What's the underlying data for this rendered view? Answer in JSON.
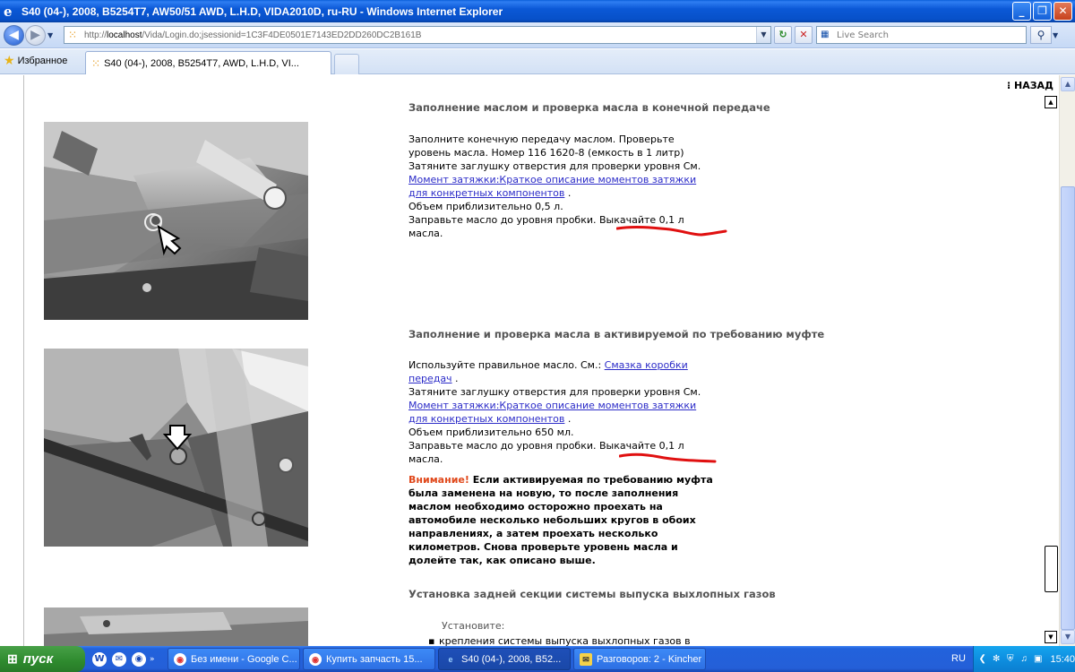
{
  "window": {
    "title": "S40 (04-), 2008, B5254T7, AW50/51 AWD, L.H.D, VIDA2010D, ru-RU - Windows Internet Explorer",
    "buttons": {
      "minimize": "_",
      "maximize": "❐",
      "close": "✕"
    }
  },
  "address_bar": {
    "url_prefix": "http://",
    "url_host": "localhost",
    "url_rest": "/Vida/Login.do;jsessionid=1C3F4DE0501E7143ED2DD260DC2B161B",
    "search_placeholder": "Live Search"
  },
  "tabs": {
    "favorites_label": "Избранное",
    "active_tab_label": "S40 (04-), 2008, B5254T7, AWD, L.H.D, VI..."
  },
  "content": {
    "back_label": "НАЗАД",
    "section1": {
      "title": "Заполнение маслом и проверка масла в конечной передаче",
      "line1": "Заполните конечную передачу маслом. Проверьте",
      "line2": "уровень масла. Номер 116 1620-8 (емкость в 1 литр)",
      "line3": "Затяните заглушку отверстия для проверки уровня См.",
      "link1": "Момент затяжки:Краткое описание моментов затяжки",
      "link2": "для конкретных компонентов",
      "link2_suffix": " .",
      "line4": "Объем приблизительно 0,5 л.",
      "line5": "Заправьте масло до уровня пробки. Выкачайте 0,1 л",
      "line6": "масла."
    },
    "section2": {
      "title": "Заполнение и проверка масла в активируемой по требованию муфте",
      "line1": "Используйте правильное масло. См.: ",
      "link0": "Смазка коробки",
      "link0b": "передач",
      "link0b_suffix": " .",
      "line2": "Затяните заглушку отверстия для проверки уровня См.",
      "link1": "Момент затяжки:Краткое описание моментов затяжки",
      "link2": "для конкретных компонентов",
      "link2_suffix": " .",
      "line3": "Объем приблизительно 650 мл.",
      "line4": "Заправьте масло до уровня пробки. Выкачайте 0,1 л",
      "line5": "масла.",
      "warning_label": "Внимание!",
      "warning_lines": [
        " Если активируемая по требованию муфта",
        "была заменена на новую, то после заполнения",
        "маслом необходимо осторожно проехать на",
        "автомобиле несколько небольших кругов в обоих",
        "направлениях, а затем проехать несколько",
        "километров. Снова проверьте уровень масла и",
        "долейте так, как описано выше."
      ]
    },
    "section3": {
      "title": "Установка задней секции системы выпуска выхлопных газов",
      "intro": "Установите:",
      "item1": "крепления системы выпуска выхлопных газов в"
    }
  },
  "taskbar": {
    "start_label": "пуск",
    "tasks": [
      "Без имени - Google C...",
      "Купить запчасть 15...",
      "S40 (04-), 2008, B52...",
      "Разговоров: 2 - Kincher"
    ],
    "language": "RU",
    "clock": "15:40"
  },
  "colors": {
    "title_bar": "#0b58d6",
    "link": "#2c2cc8",
    "warning": "#e0491c",
    "annotation_red": "#e01010",
    "section_title": "#555555"
  }
}
